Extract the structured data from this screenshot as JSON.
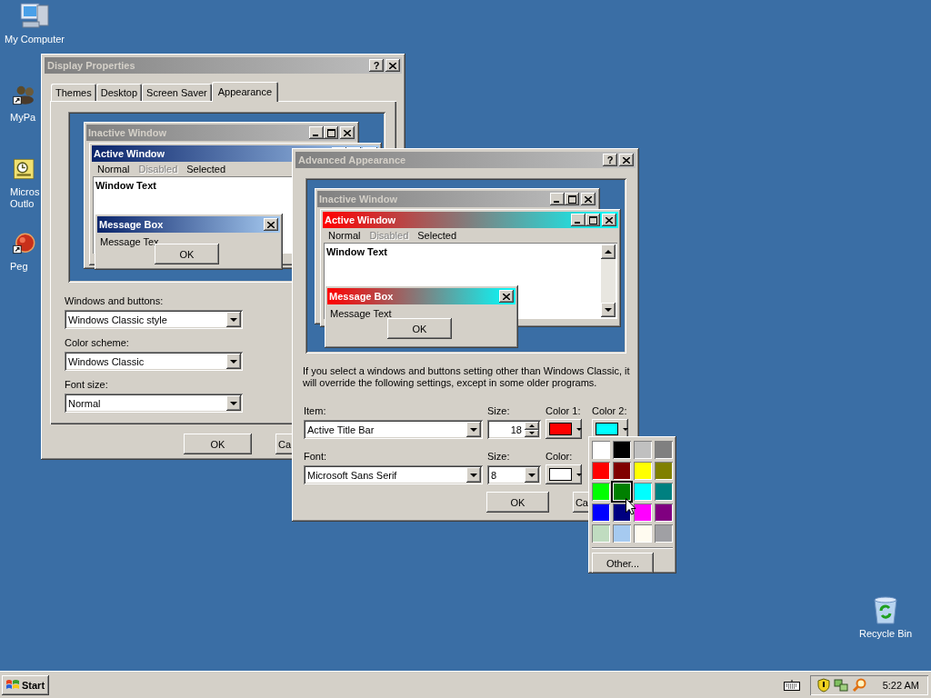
{
  "desktop_icons": [
    {
      "label": "My Computer",
      "kind": "computer"
    },
    {
      "label": "MyPa",
      "kind": "people"
    },
    {
      "label": "Micros Outlo",
      "kind": "outlook"
    },
    {
      "label": "Peg",
      "kind": "ball"
    },
    {
      "label": "Recycle Bin",
      "kind": "recycle"
    }
  ],
  "display_properties": {
    "title": "Display Properties",
    "help_button": "?",
    "tabs": [
      {
        "label": "Themes",
        "selected": false
      },
      {
        "label": "Desktop",
        "selected": false
      },
      {
        "label": "Screen Saver",
        "selected": false
      },
      {
        "label": "Appearance",
        "selected": true
      }
    ],
    "preview": {
      "inactive_title": "Inactive Window",
      "active_title": "Active Window",
      "menu": [
        {
          "label": "Normal",
          "disabled": false
        },
        {
          "label": "Disabled",
          "disabled": true
        },
        {
          "label": "Selected",
          "disabled": false
        }
      ],
      "window_text": "Window Text",
      "message_box": {
        "title": "Message Box",
        "text": "Message Tex",
        "button": "OK"
      }
    },
    "fields": [
      {
        "label": "Windows and buttons:",
        "value": "Windows Classic style"
      },
      {
        "label": "Color scheme:",
        "value": "Windows Classic"
      },
      {
        "label": "Font size:",
        "value": "Normal"
      }
    ],
    "buttons": [
      "OK",
      "Ca"
    ]
  },
  "advanced_appearance": {
    "title": "Advanced Appearance",
    "help_button": "?",
    "preview": {
      "inactive_title": "Inactive Window",
      "active_title": "Active Window",
      "menu": [
        {
          "label": "Normal",
          "disabled": false
        },
        {
          "label": "Disabled",
          "disabled": true
        },
        {
          "label": "Selected",
          "disabled": false
        }
      ],
      "window_text": "Window Text",
      "message_box": {
        "title": "Message Box",
        "text": "Message Text",
        "button": "OK"
      }
    },
    "note": "If you select a windows and buttons setting other than Windows Classic, it will override the following settings, except in some older programs.",
    "item": {
      "label": "Item:",
      "value": "Active Title Bar"
    },
    "item_size": {
      "label": "Size:",
      "value": "18"
    },
    "color_1": {
      "label": "Color 1:",
      "color": "#ff0000"
    },
    "color_2": {
      "label": "Color 2:",
      "color": "#00ffff"
    },
    "font": {
      "label": "Font:",
      "value": "Microsoft Sans Serif"
    },
    "font_size": {
      "label": "Size:",
      "value": "8"
    },
    "font_color": {
      "label": "Color:",
      "color": "#ffffff"
    },
    "buttons": [
      "OK",
      "Ca"
    ]
  },
  "color_picker": {
    "swatches": [
      {
        "color": "#ffffff",
        "selected": false
      },
      {
        "color": "#000000",
        "selected": false
      },
      {
        "color": "#c0c0c0",
        "selected": false
      },
      {
        "color": "#808080",
        "selected": false
      },
      {
        "color": "#ff0000",
        "selected": false
      },
      {
        "color": "#800000",
        "selected": false
      },
      {
        "color": "#ffff00",
        "selected": false
      },
      {
        "color": "#808000",
        "selected": false
      },
      {
        "color": "#00ff00",
        "selected": false
      },
      {
        "color": "#008000",
        "selected": true
      },
      {
        "color": "#00ffff",
        "selected": false
      },
      {
        "color": "#008080",
        "selected": false
      },
      {
        "color": "#0000ff",
        "selected": false
      },
      {
        "color": "#000080",
        "selected": false
      },
      {
        "color": "#ff00ff",
        "selected": false
      },
      {
        "color": "#800080",
        "selected": false
      },
      {
        "color": "#c0dcc0",
        "selected": false
      },
      {
        "color": "#a6caf0",
        "selected": false
      },
      {
        "color": "#fffbf0",
        "selected": false
      },
      {
        "color": "#a0a0a4",
        "selected": false
      }
    ],
    "other_button": "Other..."
  },
  "taskbar": {
    "start": "Start",
    "clock": "5:22 AM"
  }
}
